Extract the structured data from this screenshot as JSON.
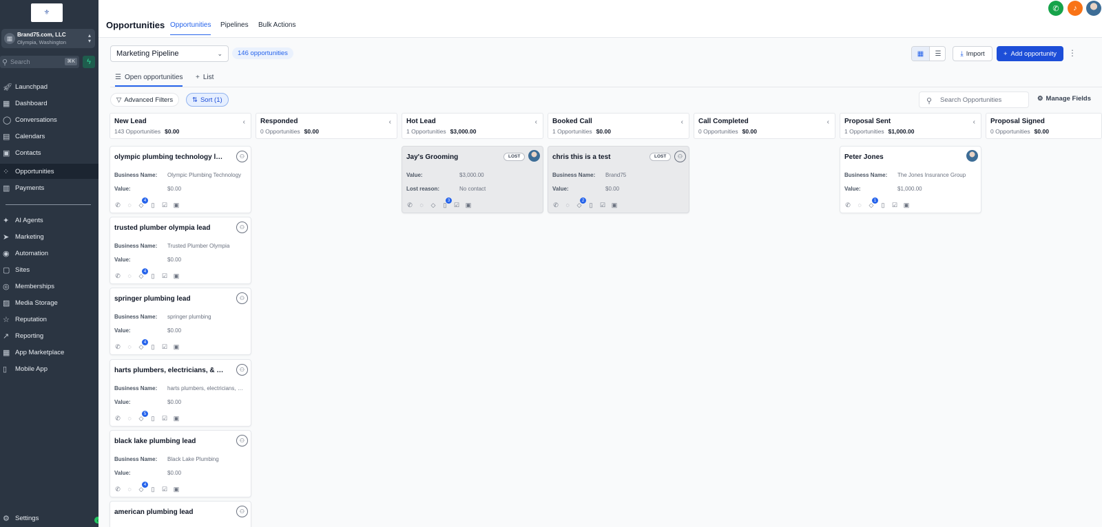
{
  "sidebar": {
    "logo_glyph": "⚜",
    "account": {
      "name": "Brand75.com, LLC",
      "location": "Olympia, Washington"
    },
    "search": {
      "placeholder": "Search",
      "shortcut": "⌘K"
    },
    "nav": [
      {
        "label": "Launchpad",
        "icon": "rocket-icon",
        "glyph": "🚀︎"
      },
      {
        "label": "Dashboard",
        "icon": "dashboard-icon",
        "glyph": "▦"
      },
      {
        "label": "Conversations",
        "icon": "chat-icon",
        "glyph": "◯"
      },
      {
        "label": "Calendars",
        "icon": "calendar-icon",
        "glyph": "▤"
      },
      {
        "label": "Contacts",
        "icon": "contacts-icon",
        "glyph": "▣"
      },
      {
        "label": "Opportunities",
        "icon": "opportunities-icon",
        "glyph": "⁘",
        "active": true
      },
      {
        "label": "Payments",
        "icon": "payments-icon",
        "glyph": "▥"
      }
    ],
    "nav2": [
      {
        "label": "AI Agents",
        "icon": "ai-agents-icon",
        "glyph": "✦"
      },
      {
        "label": "Marketing",
        "icon": "send-icon",
        "glyph": "➤"
      },
      {
        "label": "Automation",
        "icon": "automation-icon",
        "glyph": "◉"
      },
      {
        "label": "Sites",
        "icon": "sites-icon",
        "glyph": "▢"
      },
      {
        "label": "Memberships",
        "icon": "memberships-icon",
        "glyph": "◎"
      },
      {
        "label": "Media Storage",
        "icon": "image-icon",
        "glyph": "▨"
      },
      {
        "label": "Reputation",
        "icon": "star-icon",
        "glyph": "☆"
      },
      {
        "label": "Reporting",
        "icon": "trend-icon",
        "glyph": "↗"
      },
      {
        "label": "App Marketplace",
        "icon": "apps-icon",
        "glyph": "▦"
      },
      {
        "label": "Mobile App",
        "icon": "phone-icon",
        "glyph": "▯"
      }
    ],
    "settings": {
      "label": "Settings",
      "icon": "gear-icon",
      "glyph": "⚙"
    }
  },
  "header": {
    "title": "Opportunities",
    "tabs": [
      {
        "label": "Opportunities",
        "active": true
      },
      {
        "label": "Pipelines"
      },
      {
        "label": "Bulk Actions"
      }
    ]
  },
  "toolbar": {
    "pipeline": "Marketing Pipeline",
    "count_badge": "146 opportunities",
    "import_label": "Import",
    "add_label": "Add opportunity"
  },
  "subtabs": [
    {
      "label": "Open opportunities",
      "glyph": "☰"
    },
    {
      "label": "List",
      "glyph": "+"
    }
  ],
  "filters": {
    "advanced": "Advanced Filters",
    "sort": "Sort (1)",
    "search_placeholder": "Search Opportunities",
    "manage_fields": "Manage Fields"
  },
  "columns": [
    {
      "name": "New Lead",
      "count": "143 Opportunities",
      "amount": "$0.00"
    },
    {
      "name": "Responded",
      "count": "0 Opportunities",
      "amount": "$0.00"
    },
    {
      "name": "Hot Lead",
      "count": "1 Opportunities",
      "amount": "$3,000.00"
    },
    {
      "name": "Booked Call",
      "count": "1 Opportunities",
      "amount": "$0.00"
    },
    {
      "name": "Call Completed",
      "count": "0 Opportunities",
      "amount": "$0.00"
    },
    {
      "name": "Proposal Sent",
      "count": "1 Opportunities",
      "amount": "$1,000.00"
    },
    {
      "name": "Proposal Signed",
      "count": "0 Opportunities",
      "amount": "$0.00"
    }
  ],
  "labels": {
    "business_name": "Business Name:",
    "value": "Value:",
    "lost_reason": "Lost reason:",
    "lost": "LOST"
  },
  "new_lead_cards": [
    {
      "title": "olympic plumbing technology lead",
      "business": "Olympic Plumbing Technology",
      "value": "$0.00",
      "badge": "4"
    },
    {
      "title": "trusted plumber olympia lead",
      "business": "Trusted Plumber Olympia",
      "value": "$0.00",
      "badge": "4"
    },
    {
      "title": "springer plumbing lead",
      "business": "springer plumbing",
      "value": "$0.00",
      "badge": "4"
    },
    {
      "title": "harts plumbers, electricians, & hvac lead",
      "business": "harts plumbers, electricians, & hvac",
      "value": "$0.00",
      "badge": "5"
    },
    {
      "title": "black lake plumbing lead",
      "business": "Black Lake Plumbing",
      "value": "$0.00",
      "badge": "4"
    },
    {
      "title": "american plumbing lead"
    }
  ],
  "hot_lead_card": {
    "title": "Jay's Grooming",
    "value": "$3,000.00",
    "lost_reason": "No contact",
    "badge": "3"
  },
  "booked_call_card": {
    "title": "chris this is a test",
    "business": "Brand75",
    "value": "$0.00",
    "badge": "2"
  },
  "proposal_card": {
    "title": "Peter Jones",
    "business": "The Jones Insurance Group",
    "value": "$1,000.00",
    "badge": "1"
  },
  "colors": {
    "sidebar": "#2b3542",
    "accent": "#2563eb",
    "phone": "#16a34a",
    "notification": "#f97316"
  }
}
